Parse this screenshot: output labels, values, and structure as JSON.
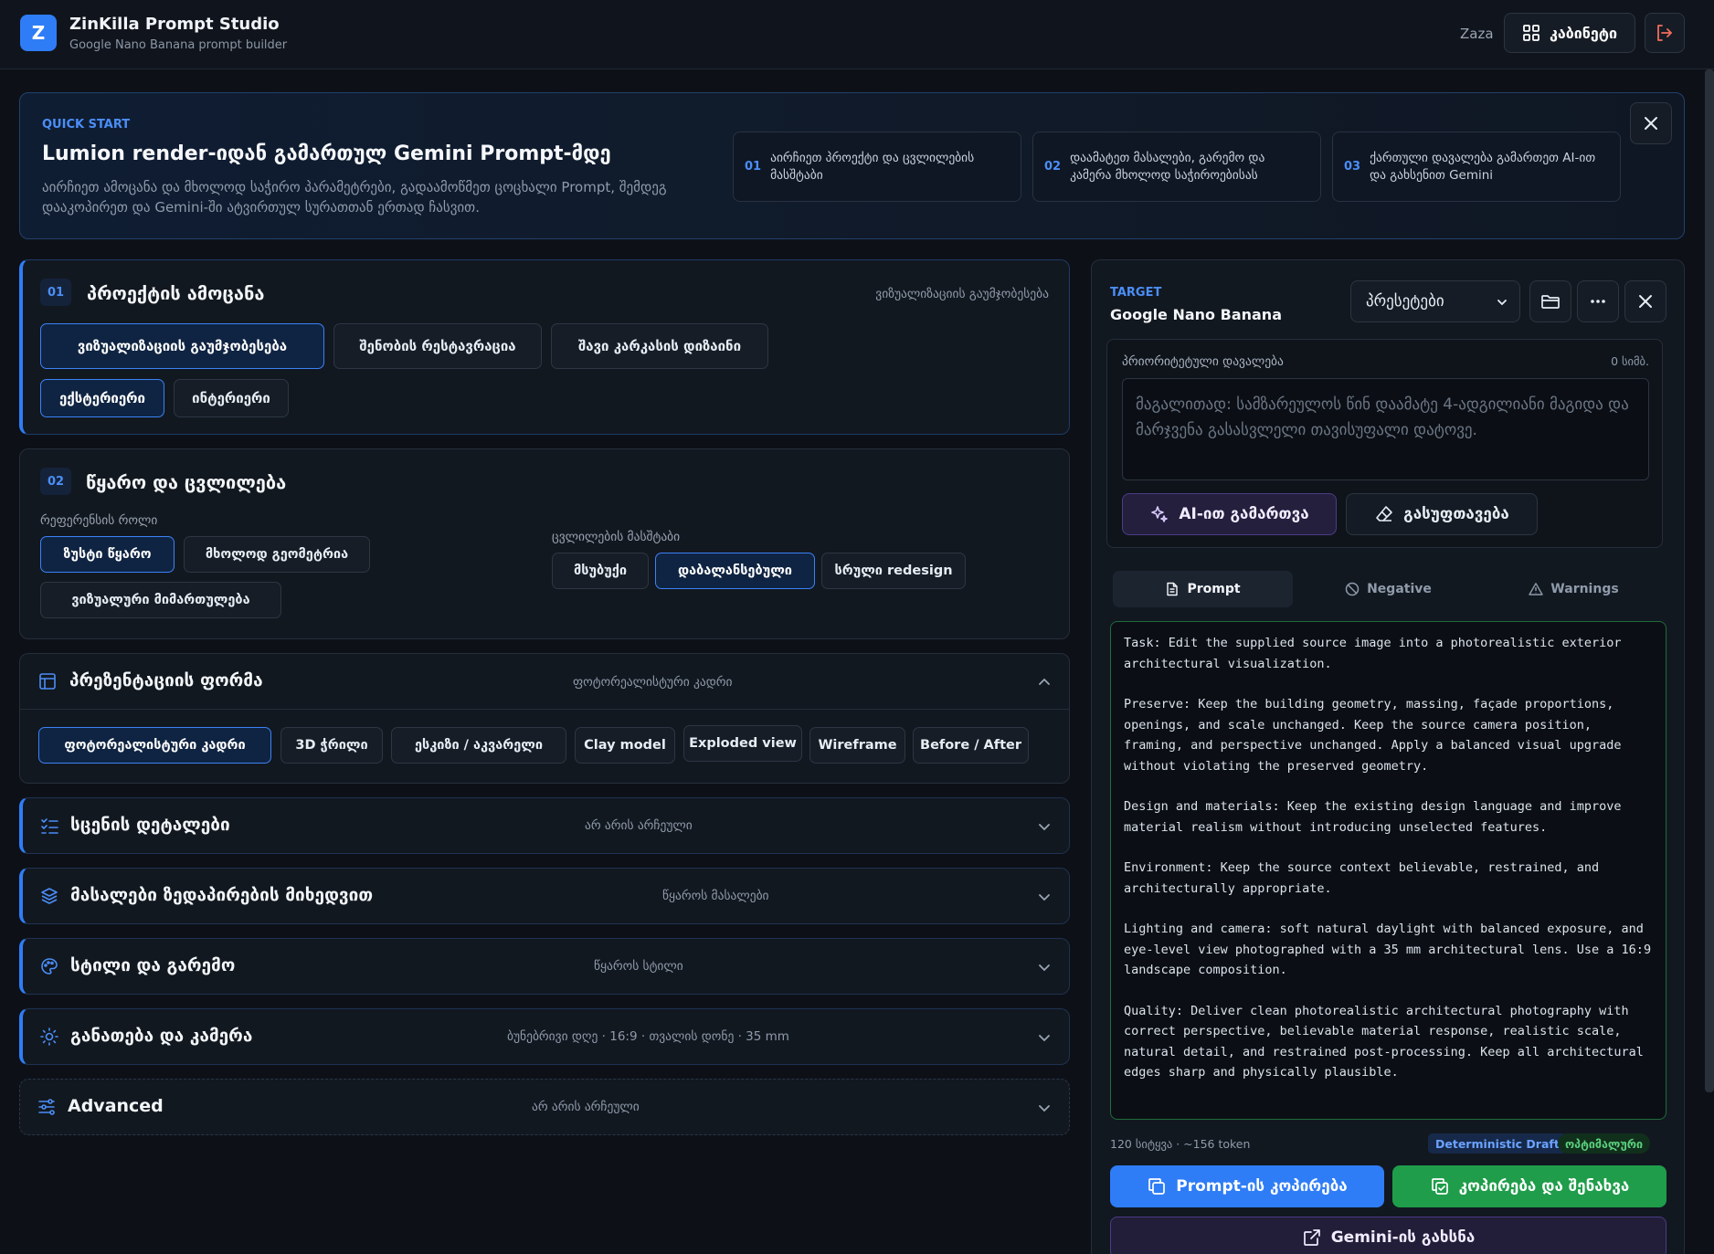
{
  "header": {
    "logo_letter": "Z",
    "title": "ZinKilla Prompt Studio",
    "subtitle": "Google Nano Banana prompt builder",
    "user": "Zaza",
    "cabinet_label": "კაბინეტი"
  },
  "quick_start": {
    "tag": "QUICK START",
    "title": "Lumion render-იდან გამართულ Gemini Prompt-მდე",
    "description": "აირჩიეთ ამოცანა და მხოლოდ საჭირო პარამეტრები, გადაამოწმეთ ცოცხალი Prompt, შემდეგ დააკოპირეთ და Gemini-ში ატვირთულ სურათთან ერთად ჩასვით.",
    "steps": [
      {
        "num": "01",
        "text": "აირჩიეთ პროექტი და ცვლილების მასშტაბი"
      },
      {
        "num": "02",
        "text": "დაამატეთ მასალები, გარემო და კამერა მხოლოდ საჭიროებისას"
      },
      {
        "num": "03",
        "text": "ქართული დავალება გამართეთ AI-ით და გახსენით Gemini"
      }
    ]
  },
  "section1": {
    "num": "01",
    "title": "პროექტის ამოცანა",
    "meta": "ვიზუალიზაციის გაუმჯობესება",
    "tasks": [
      "ვიზუალიზაციის გაუმჯობესება",
      "შენობის რესტავრაცია",
      "შავი კარკასის დიზაინი"
    ],
    "scopes": [
      "ექსტერიერი",
      "ინტერიერი"
    ]
  },
  "section2": {
    "num": "02",
    "title": "წყარო და ცვლილება",
    "ref_label": "რეფერენსის როლი",
    "ref_options": [
      "ზუსტი წყარო",
      "მხოლოდ გეომეტრია",
      "ვიზუალური მიმართულება"
    ],
    "scale_label": "ცვლილების მასშტაბი",
    "scale_options": [
      "მსუბუქი",
      "დაბალანსებული",
      "სრული redesign"
    ]
  },
  "section3": {
    "title": "პრეზენტაციის ფორმა",
    "meta": "ფოტორეალისტური კადრი",
    "options": [
      "ფოტორეალისტური კადრი",
      "3D ჭრილი",
      "ესკიზი / აკვარელი",
      "Clay model",
      "Exploded view",
      "Wireframe",
      "Before / After"
    ]
  },
  "accordions": [
    {
      "title": "სცენის დეტალები",
      "meta": "არ არის არჩეული"
    },
    {
      "title": "მასალები ზედაპირების მიხედვით",
      "meta": "წყაროს მასალები"
    },
    {
      "title": "სტილი და გარემო",
      "meta": "წყაროს სტილი"
    },
    {
      "title": "განათება და კამერა",
      "meta": "ბუნებრივი დღე · 16:9 · თვალის დონე · 35 mm"
    },
    {
      "title": "Advanced",
      "meta": "არ არის არჩეული"
    }
  ],
  "panel": {
    "target_tag": "TARGET",
    "model": "Google Nano Banana",
    "preset_label": "პრესეტები",
    "priority_label": "პრიორიტეტული დავალება",
    "priority_count": "0 სიმბ.",
    "priority_placeholder": "მაგალითად: სამზარეულოს წინ დაამატე 4-ადგილიანი მაგიდა და მარჯვენა გასასვლელი თავისუფალი დატოვე.",
    "ai_button": "AI-ით გამართვა",
    "clear_button": "გასუფთავება",
    "tabs": [
      "Prompt",
      "Negative",
      "Warnings"
    ],
    "prompt_paragraphs": [
      "Task: Edit the supplied source image into a photorealistic exterior architectural visualization.",
      "Preserve: Keep the building geometry, massing, façade proportions, openings, and scale unchanged. Keep the source camera position, framing, and perspective unchanged. Apply a balanced visual upgrade without violating the preserved geometry.",
      "Design and materials: Keep the existing design language and improve material realism without introducing unselected features.",
      "Environment: Keep the source context believable, restrained, and architecturally appropriate.",
      "Lighting and camera: soft natural daylight with balanced exposure, and eye-level view photographed with a 35 mm architectural lens. Use a 16:9 landscape composition.",
      "Quality: Deliver clean photorealistic architectural photography with correct perspective, believable material response, realistic scale, natural detail, and restrained post-processing. Keep all architectural edges sharp and physically plausible."
    ],
    "stats": "120 სიტყვა · ~156 token",
    "mode_tag": "Deterministic Draft",
    "status_tag": "ოპტიმალური",
    "copy_button": "Prompt-ის კოპირება",
    "save_button": "კოპირება და შენახვა",
    "gemini_button": "Gemini-ის გახსნა"
  },
  "colors": {
    "accent": "#2f7df6",
    "success": "#1f9d4a",
    "ai": "#241f3d"
  }
}
